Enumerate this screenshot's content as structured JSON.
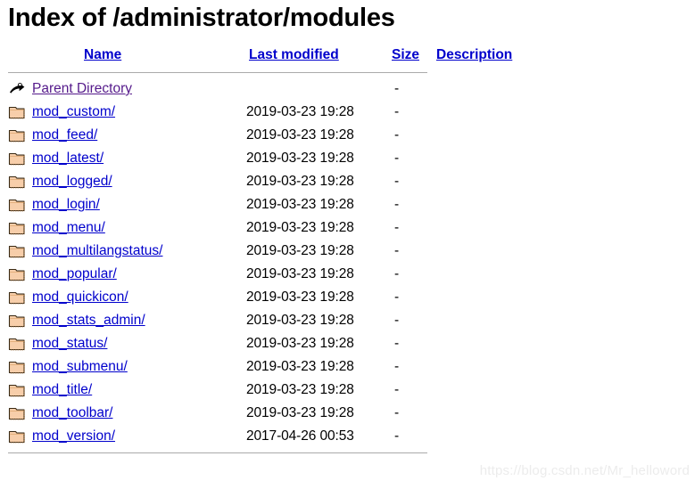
{
  "page": {
    "title": "Index of /administrator/modules",
    "watermark": "https://blog.csdn.net/Mr_helloword"
  },
  "table": {
    "headers": {
      "icon": "",
      "name": "Name",
      "last_modified": "Last modified",
      "size": "Size",
      "description": "Description"
    },
    "parent": {
      "icon": "back-arrow-icon",
      "name": "Parent Directory",
      "last_modified": "",
      "size": "-",
      "description": ""
    },
    "rows": [
      {
        "icon": "folder-icon",
        "name": "mod_custom/",
        "last_modified": "2019-03-23 19:28",
        "size": "-",
        "description": ""
      },
      {
        "icon": "folder-icon",
        "name": "mod_feed/",
        "last_modified": "2019-03-23 19:28",
        "size": "-",
        "description": ""
      },
      {
        "icon": "folder-icon",
        "name": "mod_latest/",
        "last_modified": "2019-03-23 19:28",
        "size": "-",
        "description": ""
      },
      {
        "icon": "folder-icon",
        "name": "mod_logged/",
        "last_modified": "2019-03-23 19:28",
        "size": "-",
        "description": ""
      },
      {
        "icon": "folder-icon",
        "name": "mod_login/",
        "last_modified": "2019-03-23 19:28",
        "size": "-",
        "description": ""
      },
      {
        "icon": "folder-icon",
        "name": "mod_menu/",
        "last_modified": "2019-03-23 19:28",
        "size": "-",
        "description": ""
      },
      {
        "icon": "folder-icon",
        "name": "mod_multilangstatus/",
        "last_modified": "2019-03-23 19:28",
        "size": "-",
        "description": ""
      },
      {
        "icon": "folder-icon",
        "name": "mod_popular/",
        "last_modified": "2019-03-23 19:28",
        "size": "-",
        "description": ""
      },
      {
        "icon": "folder-icon",
        "name": "mod_quickicon/",
        "last_modified": "2019-03-23 19:28",
        "size": "-",
        "description": ""
      },
      {
        "icon": "folder-icon",
        "name": "mod_stats_admin/",
        "last_modified": "2019-03-23 19:28",
        "size": "-",
        "description": ""
      },
      {
        "icon": "folder-icon",
        "name": "mod_status/",
        "last_modified": "2019-03-23 19:28",
        "size": "-",
        "description": ""
      },
      {
        "icon": "folder-icon",
        "name": "mod_submenu/",
        "last_modified": "2019-03-23 19:28",
        "size": "-",
        "description": ""
      },
      {
        "icon": "folder-icon",
        "name": "mod_title/",
        "last_modified": "2019-03-23 19:28",
        "size": "-",
        "description": ""
      },
      {
        "icon": "folder-icon",
        "name": "mod_toolbar/",
        "last_modified": "2019-03-23 19:28",
        "size": "-",
        "description": ""
      },
      {
        "icon": "folder-icon",
        "name": "mod_version/",
        "last_modified": "2017-04-26 00:53",
        "size": "-",
        "description": ""
      }
    ]
  },
  "colors": {
    "link": "#0000cc",
    "visited_link": "#551a8b",
    "rule": "#aaaaaa",
    "text": "#000000",
    "folder_fill": "#f5c89a",
    "folder_outline": "#3a2a14",
    "watermark": "#ececec"
  }
}
